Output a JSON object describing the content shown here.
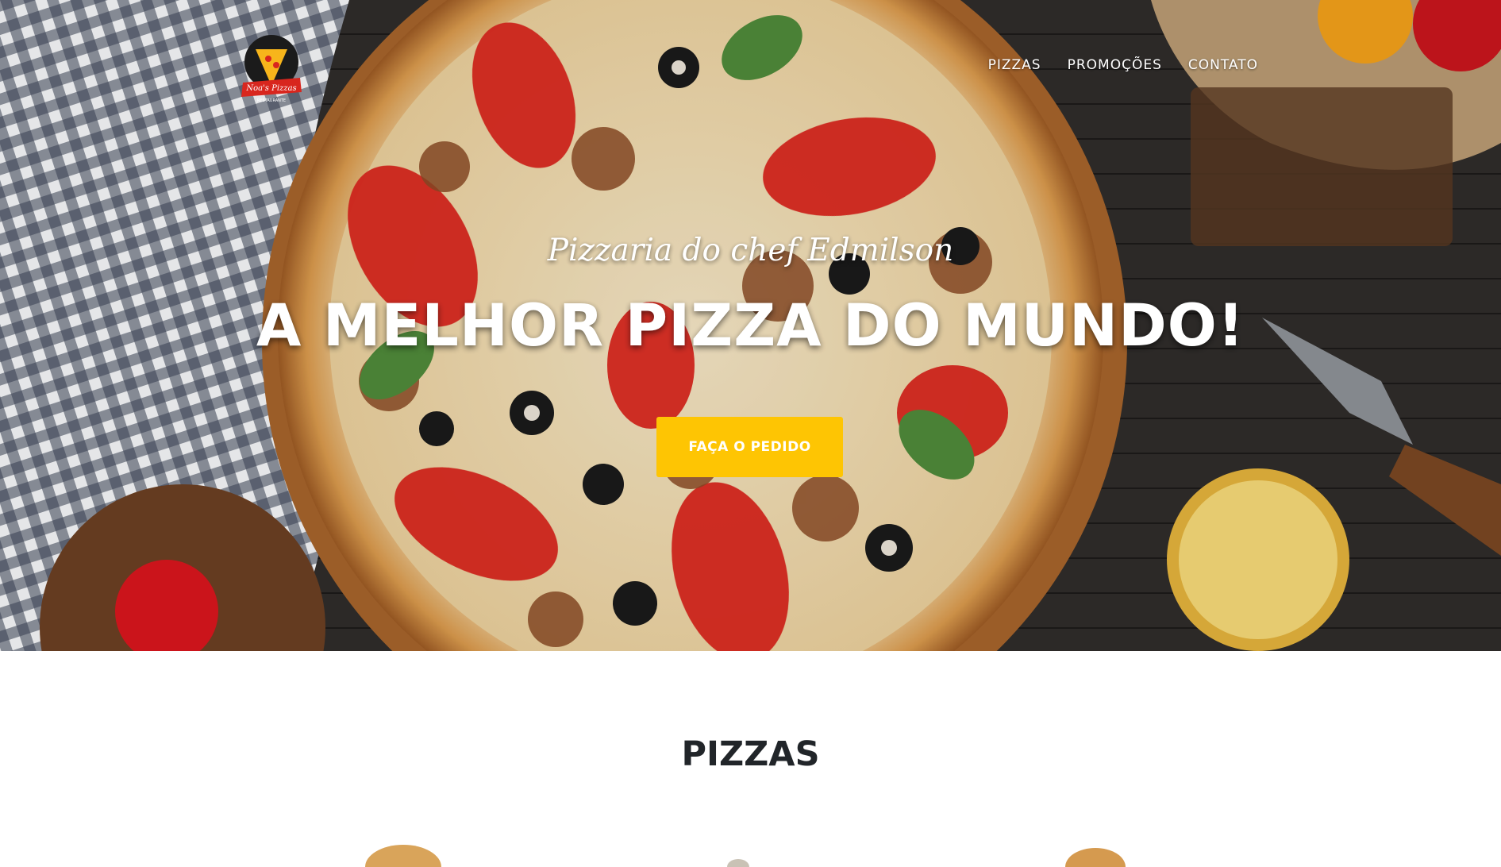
{
  "brand": {
    "logo_text": "Noa's Pizzas",
    "logo_sub": "RESTAURANTE"
  },
  "nav": {
    "items": [
      "PIZZAS",
      "PROMOÇÕES",
      "CONTATO"
    ]
  },
  "hero": {
    "subtitle": "Pizzaria do chef Edmilson",
    "headline": "A MELHOR PIZZA DO MUNDO!",
    "cta_label": "FAÇA O PEDIDO"
  },
  "sections": {
    "pizzas_title": "PIZZAS"
  },
  "colors": {
    "accent": "#fec503",
    "heading": "#212529",
    "nav_text": "#ffffff"
  }
}
